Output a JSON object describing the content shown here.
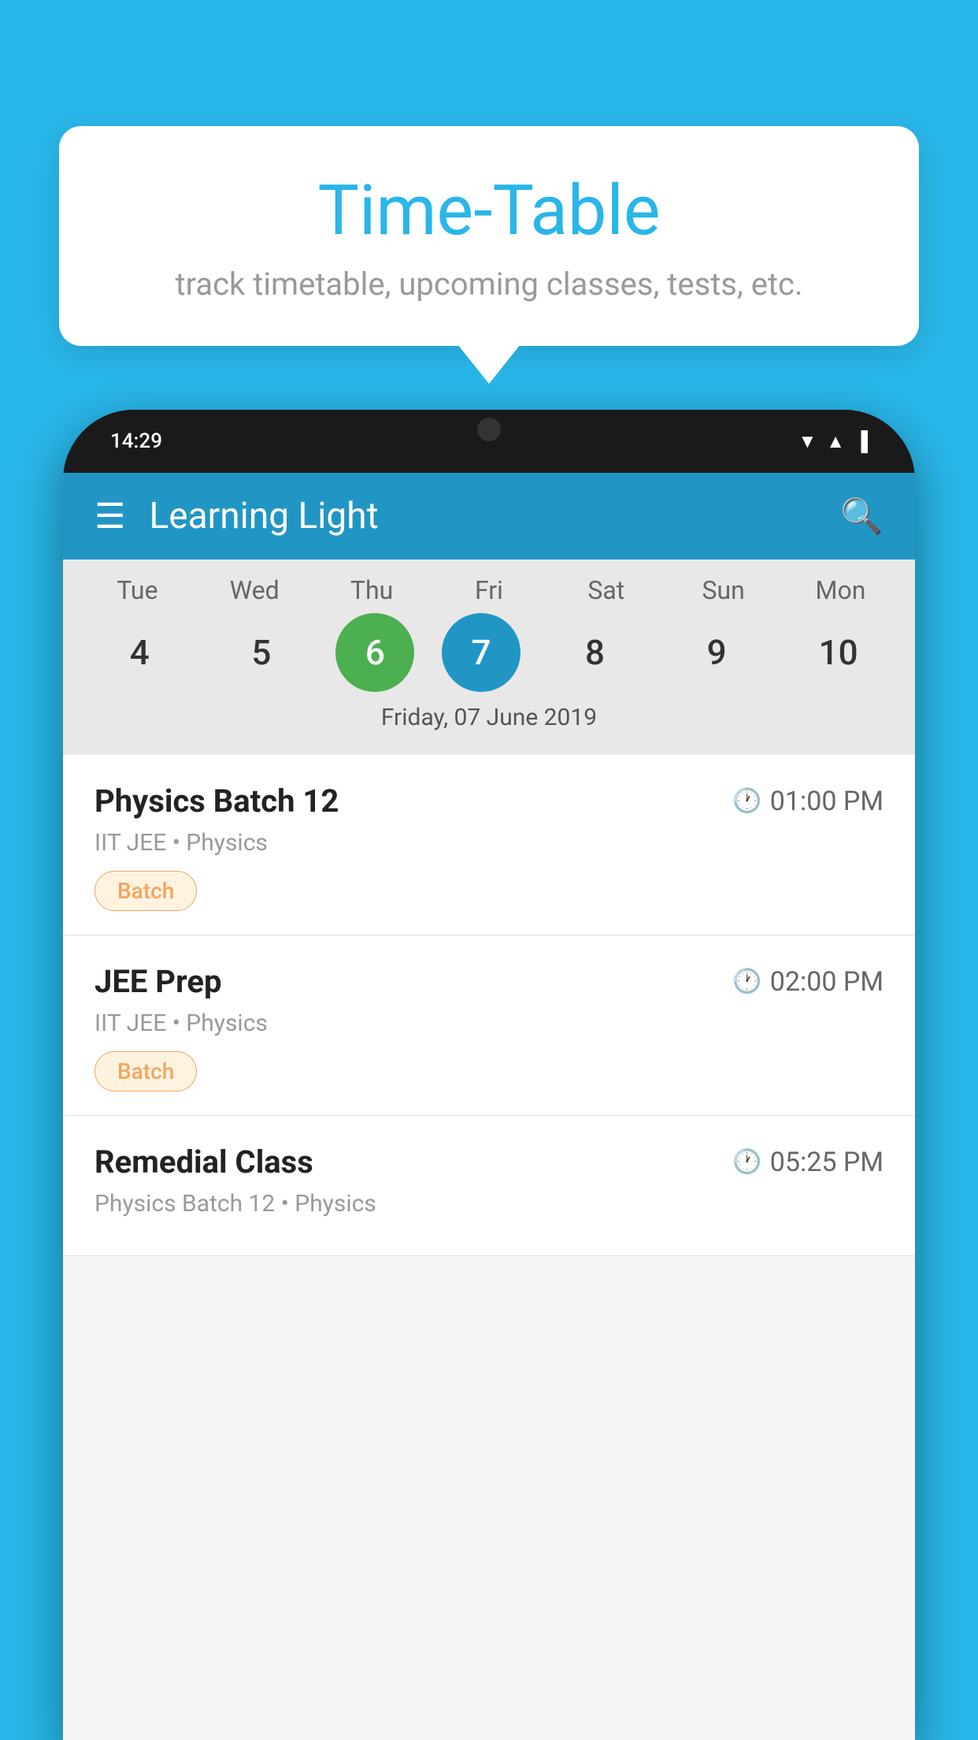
{
  "background_color": "#29B6E8",
  "tooltip": {
    "title": "Time-Table",
    "subtitle": "track timetable, upcoming classes, tests, etc."
  },
  "phone": {
    "status_bar": {
      "time": "14:29"
    },
    "app_bar": {
      "title": "Learning Light"
    },
    "calendar": {
      "days": [
        {
          "label": "Tue",
          "number": "4"
        },
        {
          "label": "Wed",
          "number": "5"
        },
        {
          "label": "Thu",
          "number": "6",
          "state": "today"
        },
        {
          "label": "Fri",
          "number": "7",
          "state": "selected"
        },
        {
          "label": "Sat",
          "number": "8"
        },
        {
          "label": "Sun",
          "number": "9"
        },
        {
          "label": "Mon",
          "number": "10"
        }
      ],
      "selected_date_label": "Friday, 07 June 2019"
    },
    "classes": [
      {
        "name": "Physics Batch 12",
        "time": "01:00 PM",
        "meta": "IIT JEE • Physics",
        "badge": "Batch"
      },
      {
        "name": "JEE Prep",
        "time": "02:00 PM",
        "meta": "IIT JEE • Physics",
        "badge": "Batch"
      },
      {
        "name": "Remedial Class",
        "time": "05:25 PM",
        "meta": "Physics Batch 12 • Physics",
        "badge": null
      }
    ]
  },
  "labels": {
    "hamburger": "☰",
    "search": "🔍",
    "clock": "🕐",
    "wifi": "▲",
    "signal": "▲",
    "battery": "▐"
  }
}
